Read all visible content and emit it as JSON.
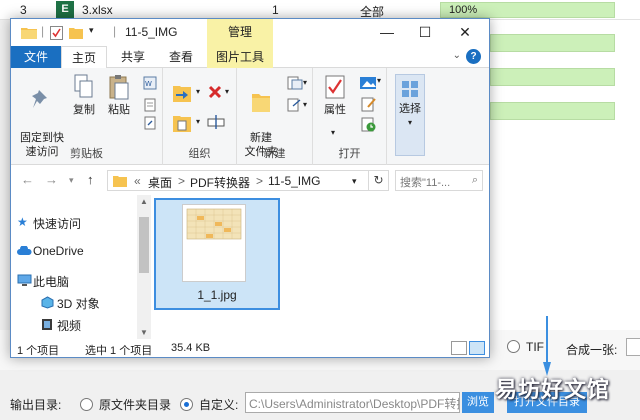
{
  "background_app": {
    "row": {
      "num": "3",
      "file_badge": "E",
      "name": "3.xlsx",
      "pages": "1",
      "range": "全部",
      "progress": "100%"
    },
    "tif_label": "TIF",
    "merge_label": "合成一张:",
    "output_label": "输出目录:",
    "option_source": "原文件夹目录",
    "option_custom": "自定义:",
    "path_value": "C:\\Users\\Administrator\\Desktop\\PDF转换器",
    "browse_label": "浏览",
    "open_dir_label": "打开文件目录",
    "watermark": "易坊好文馆",
    "accent_color": "#3b8fe0",
    "progress_color": "#ccf0b9"
  },
  "explorer": {
    "title": "11-5_IMG",
    "manage_tab": "管理",
    "tabs": {
      "file": "文件",
      "home": "主页",
      "share": "共享",
      "view": "查看",
      "picture_tools": "图片工具"
    },
    "ribbon": {
      "pin_label": "固定到快\n速访问",
      "copy_label": "复制",
      "paste_label": "粘贴",
      "clipboard_group": "剪贴板",
      "organize_group": "组织",
      "new_folder_label": "新建\n文件夹",
      "new_group": "新建",
      "properties_label": "属性",
      "open_group": "打开",
      "select_label": "选择"
    },
    "address": {
      "crumb_prefix": "«",
      "crumb1": "桌面",
      "sep1": ">",
      "crumb2": "PDF转换器",
      "sep2": ">",
      "crumb3": "11-5_IMG"
    },
    "search_placeholder": "搜索\"11-...",
    "navpane": [
      {
        "label": "快速访问",
        "icon": "star-icon"
      },
      {
        "label": "OneDrive",
        "icon": "cloud-icon"
      },
      {
        "label": "此电脑",
        "icon": "pc-icon"
      },
      {
        "label": "3D 对象",
        "icon": "cube-icon"
      },
      {
        "label": "视频",
        "icon": "video-icon"
      }
    ],
    "file": {
      "name": "1_1.jpg"
    },
    "status": {
      "count": "1 个项目",
      "selected": "选中 1 个项目",
      "size": "35.4 KB"
    },
    "title_accent": "#1a6fc1"
  }
}
